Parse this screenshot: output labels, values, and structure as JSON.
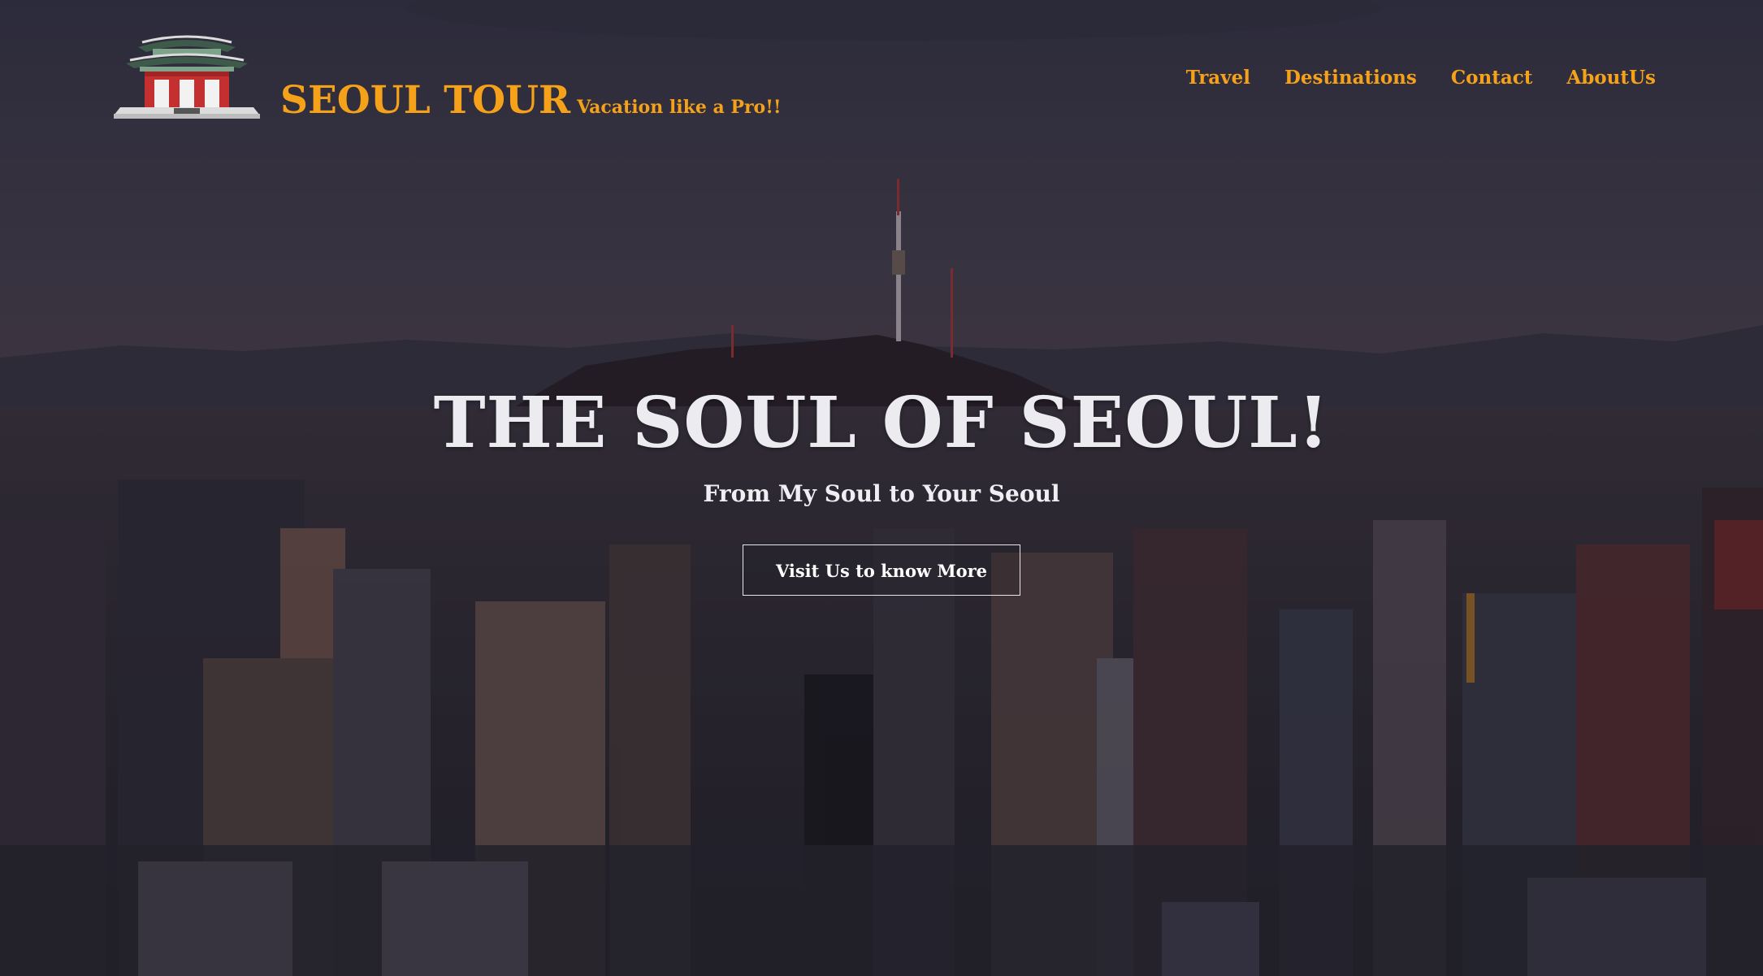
{
  "header": {
    "brand_title": "SEOUL TOUR",
    "brand_tagline": "Vacation like a Pro!!",
    "nav": [
      {
        "label": "Travel"
      },
      {
        "label": "Destinations"
      },
      {
        "label": "Contact"
      },
      {
        "label": "AboutUs"
      }
    ]
  },
  "hero": {
    "title": "THE SOUL OF SEOUL!",
    "subtitle": "From My Soul to Your Seoul",
    "cta_label": "Visit Us to know More"
  },
  "colors": {
    "accent": "#f5a119",
    "hero_text": "#ececf0",
    "sky": "#4a4552"
  },
  "icons": {
    "logo": "korean-palace-gate-logo"
  }
}
